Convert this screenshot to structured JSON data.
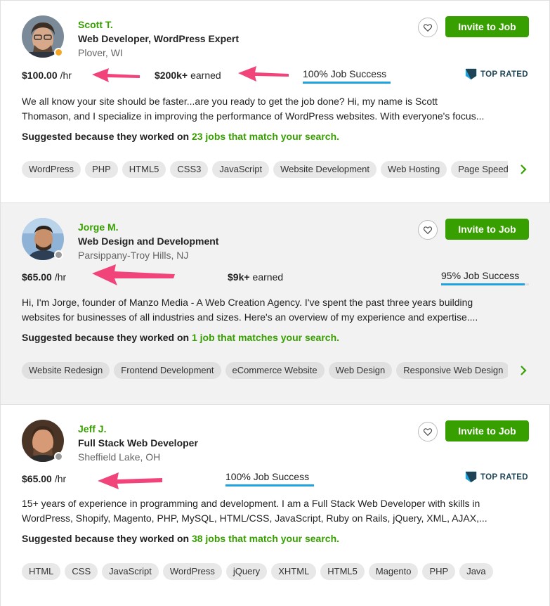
{
  "freelancers": [
    {
      "name": "Scott T.",
      "title": "Web Developer, WordPress Expert",
      "location": "Plover, WI",
      "status": "online",
      "rate": "$100.00",
      "rate_unit": "/hr",
      "earned": "$200k+",
      "earned_label": "earned",
      "job_success": "100% Job Success",
      "job_success_pct": 100,
      "badge": "TOP RATED",
      "desc_line1": "We all know your site should be faster...are you ready to get the job done? Hi, my name is Scott",
      "desc_line2": "Thomason, and I specialize in improving the performance of WordPress websites. With everyone's focus...",
      "suggested_prefix": "Suggested because they worked on",
      "suggested_link": "23 jobs that match your search.",
      "skills": [
        "WordPress",
        "PHP",
        "HTML5",
        "CSS3",
        "JavaScript",
        "Website Development",
        "Web Hosting",
        "Page Speed"
      ],
      "avatar_colors": {
        "bg": "#7a8a98",
        "face": "#d8a88a",
        "hair": "#3a2e25"
      }
    },
    {
      "name": "Jorge M.",
      "title": "Web Design and Development",
      "location": "Parsippany-Troy Hills, NJ",
      "status": "offline",
      "rate": "$65.00",
      "rate_unit": "/hr",
      "earned": "$9k+",
      "earned_label": "earned",
      "job_success": "95% Job Success",
      "job_success_pct": 95,
      "badge": "",
      "desc_line1": "Hi, I'm Jorge, founder of Manzo Media - A Web Creation Agency. I've spent the past three years building",
      "desc_line2": "websites for businesses of all industries and sizes. Here's an overview of my experience and expertise....",
      "suggested_prefix": "Suggested because they worked on",
      "suggested_link": "1 job that matches your search.",
      "skills": [
        "Website Redesign",
        "Frontend Development",
        "eCommerce Website",
        "Web Design",
        "Responsive Web Design"
      ],
      "avatar_colors": {
        "bg": "#8fb3d6",
        "face": "#c9906c",
        "hair": "#2a211b"
      }
    },
    {
      "name": "Jeff J.",
      "title": "Full Stack Web Developer",
      "location": "Sheffield Lake, OH",
      "status": "offline",
      "rate": "$65.00",
      "rate_unit": "/hr",
      "earned": "",
      "earned_label": "",
      "job_success": "100% Job Success",
      "job_success_pct": 100,
      "badge": "TOP RATED",
      "desc_line1": "15+ years of experience in programming and development. I am a Full Stack Web Developer with skills in",
      "desc_line2": "WordPress, Shopify, Magento, PHP, MySQL, HTML/CSS, JavaScript, Ruby on Rails, jQuery, XML, AJAX,...",
      "suggested_prefix": "Suggested because they worked on",
      "suggested_link": "38 jobs that match your search.",
      "skills": [
        "HTML",
        "CSS",
        "JavaScript",
        "WordPress",
        "jQuery",
        "XHTML",
        "HTML5",
        "Magento",
        "PHP",
        "Java"
      ],
      "avatar_colors": {
        "bg": "#4a3426",
        "face": "#d69a76",
        "hair": "#3b2a1d"
      }
    }
  ],
  "invite_label": "Invite to Job",
  "colors": {
    "accent": "#37a000",
    "bar": "#1fa3e0",
    "arrow": "#f0447a",
    "badge": "#1d4354"
  }
}
